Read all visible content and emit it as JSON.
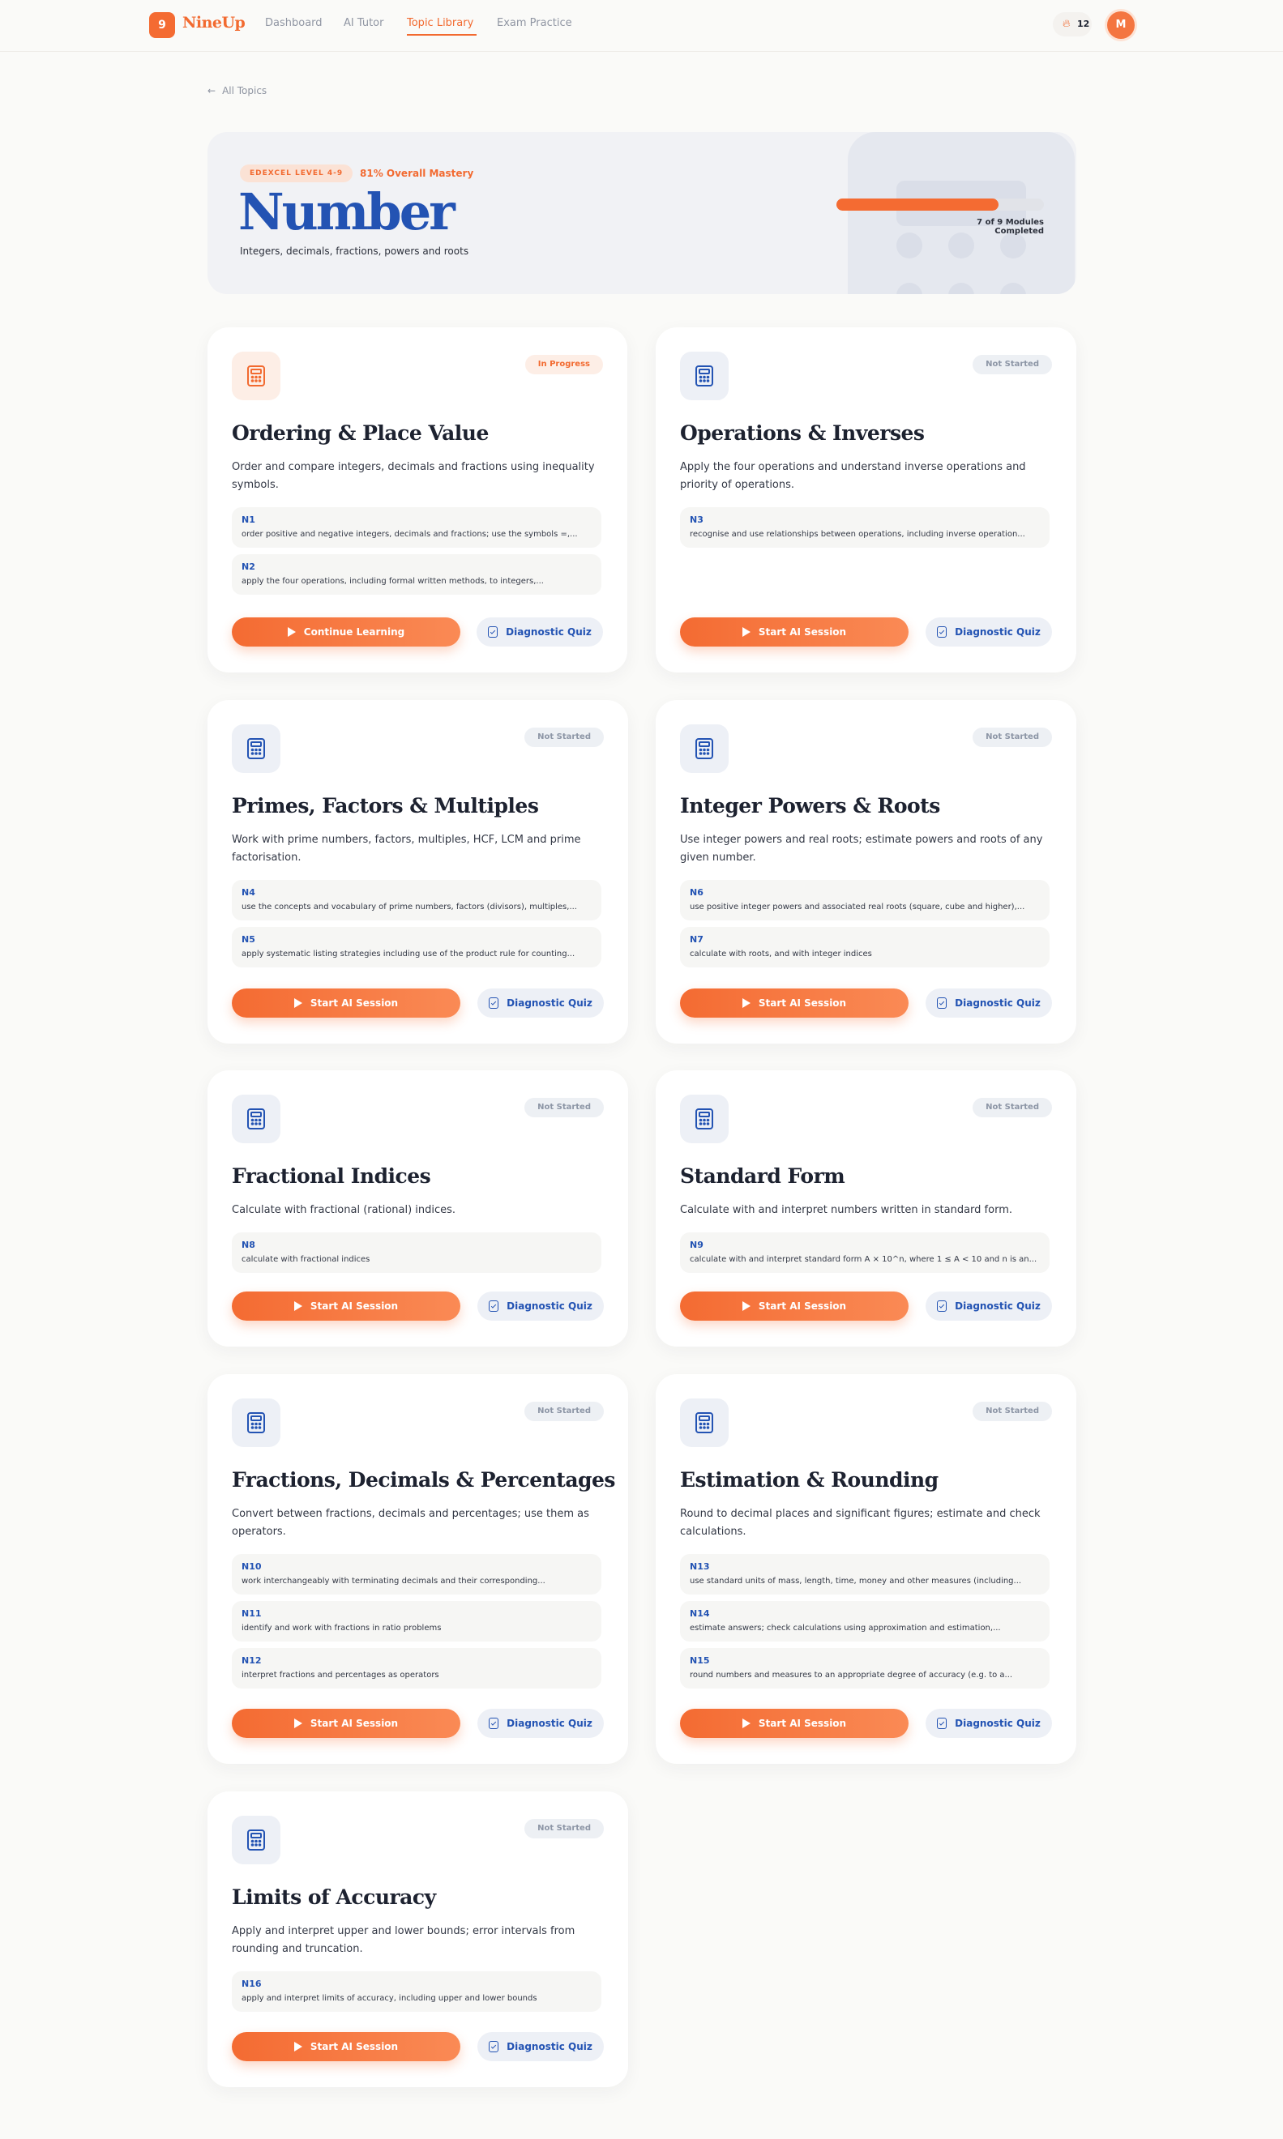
{
  "nav": {
    "logo_badge": "9",
    "logo_text": "NineUp",
    "links": [
      "Dashboard",
      "AI Tutor",
      "Topic Library",
      "Exam Practice"
    ],
    "streak_count": "12",
    "avatar_initial": "M"
  },
  "back_label": "All Topics",
  "hero": {
    "level": "EDEXCEL LEVEL 4-9",
    "mastery": "81% Overall Mastery",
    "title": "Number",
    "subtitle": "Integers, decimals, fractions, powers and roots",
    "progress_fraction": 0.78,
    "modules_completed": "7 of 9 Modules Completed"
  },
  "labels": {
    "diagnostic_quiz": "Diagnostic Quiz"
  },
  "colors": {
    "accent": "#f46b32",
    "brand_blue": "#2353b3",
    "background": "#fafaf8"
  },
  "cards": [
    {
      "status": "In Progress",
      "title": "Ordering & Place Value",
      "description": "Order and compare integers, decimals and fractions using inequality symbols.",
      "objectives": [
        {
          "code": "N1",
          "text": "order positive and negative integers, decimals and fractions; use the symbols =,..."
        },
        {
          "code": "N2",
          "text": "apply the four operations, including formal written methods, to integers,..."
        }
      ],
      "primary_label": "Continue Learning"
    },
    {
      "status": "Not Started",
      "title": "Operations & Inverses",
      "description": "Apply the four operations and understand inverse operations and priority of operations.",
      "objectives": [
        {
          "code": "N3",
          "text": "recognise and use relationships between operations, including inverse operation..."
        }
      ],
      "primary_label": "Start AI Session"
    },
    {
      "status": "Not Started",
      "title": "Primes, Factors & Multiples",
      "description": "Work with prime numbers, factors, multiples, HCF, LCM and prime factorisation.",
      "objectives": [
        {
          "code": "N4",
          "text": "use the concepts and vocabulary of prime numbers, factors (divisors), multiples,..."
        },
        {
          "code": "N5",
          "text": "apply systematic listing strategies including use of the product rule for counting..."
        }
      ],
      "primary_label": "Start AI Session"
    },
    {
      "status": "Not Started",
      "title": "Integer Powers & Roots",
      "description": "Use integer powers and real roots; estimate powers and roots of any given number.",
      "objectives": [
        {
          "code": "N6",
          "text": "use positive integer powers and associated real roots (square, cube and higher),..."
        },
        {
          "code": "N7",
          "text": "calculate with roots, and with integer indices"
        }
      ],
      "primary_label": "Start AI Session"
    },
    {
      "status": "Not Started",
      "title": "Fractional Indices",
      "description": "Calculate with fractional (rational) indices.",
      "objectives": [
        {
          "code": "N8",
          "text": "calculate with fractional indices"
        }
      ],
      "primary_label": "Start AI Session"
    },
    {
      "status": "Not Started",
      "title": "Standard Form",
      "description": "Calculate with and interpret numbers written in standard form.",
      "objectives": [
        {
          "code": "N9",
          "text": "calculate with and interpret standard form A × 10^n, where 1 ≤ A < 10 and n is an..."
        }
      ],
      "primary_label": "Start AI Session"
    },
    {
      "status": "Not Started",
      "title": "Fractions, Decimals & Percentages",
      "description": "Convert between fractions, decimals and percentages; use them as operators.",
      "objectives": [
        {
          "code": "N10",
          "text": "work interchangeably with terminating decimals and their corresponding..."
        },
        {
          "code": "N11",
          "text": "identify and work with fractions in ratio problems"
        },
        {
          "code": "N12",
          "text": "interpret fractions and percentages as operators"
        }
      ],
      "primary_label": "Start AI Session"
    },
    {
      "status": "Not Started",
      "title": "Estimation & Rounding",
      "description": "Round to decimal places and significant figures; estimate and check calculations.",
      "objectives": [
        {
          "code": "N13",
          "text": "use standard units of mass, length, time, money and other measures (including..."
        },
        {
          "code": "N14",
          "text": "estimate answers; check calculations using approximation and estimation,..."
        },
        {
          "code": "N15",
          "text": "round numbers and measures to an appropriate degree of accuracy (e.g. to a..."
        }
      ],
      "primary_label": "Start AI Session"
    },
    {
      "status": "Not Started",
      "title": "Limits of Accuracy",
      "description": "Apply and interpret upper and lower bounds; error intervals from rounding and truncation.",
      "objectives": [
        {
          "code": "N16",
          "text": "apply and interpret limits of accuracy, including upper and lower bounds"
        }
      ],
      "primary_label": "Start AI Session"
    }
  ]
}
